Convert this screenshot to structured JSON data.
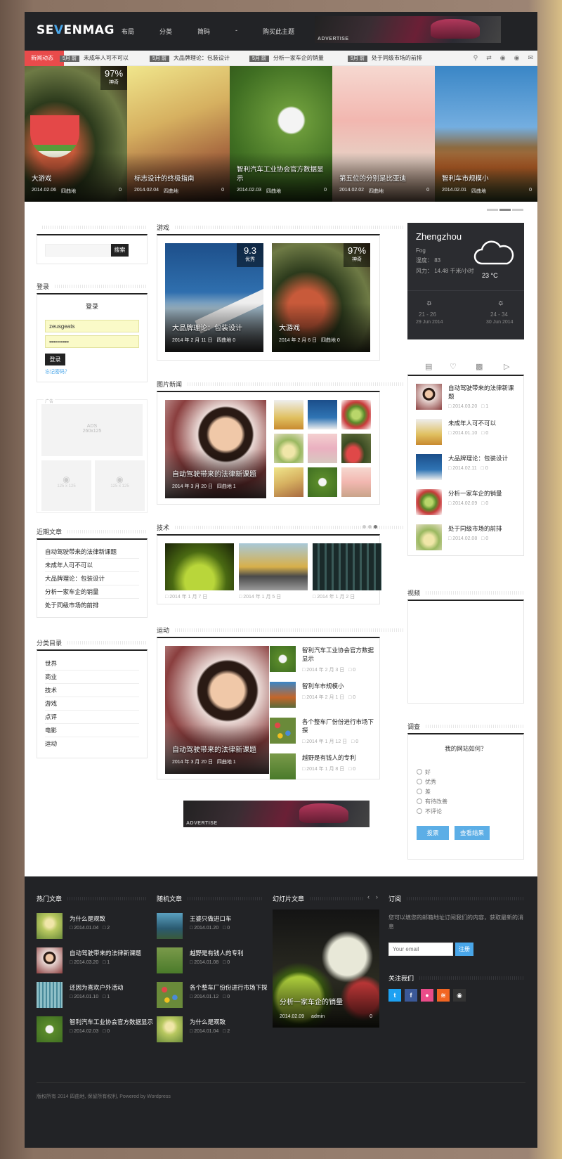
{
  "header": {
    "logo_a": "SE",
    "logo_b": "V",
    "logo_c": "ENMAG",
    "nav": [
      "布局",
      "分类",
      "简码",
      "-",
      "购买此主题"
    ],
    "advertise": "ADVERTISE"
  },
  "ticker": {
    "label": "新闻动态",
    "items": [
      {
        "age": "5月 前",
        "title": "未成年人可不可以"
      },
      {
        "age": "5月 前",
        "title": "大品牌理论：包装设计"
      },
      {
        "age": "5月 前",
        "title": "分析一家车企的销量"
      },
      {
        "age": "5月 前",
        "title": "处于同级市场的前排"
      }
    ]
  },
  "slider": [
    {
      "title": "大游戏",
      "date": "2014.02.06",
      "author": "四曲地",
      "comments": "0",
      "score": "97%",
      "score_label": "神奇"
    },
    {
      "title": "标志设计的终极指南",
      "date": "2014.02.04",
      "author": "四曲地",
      "comments": "0"
    },
    {
      "title": "智利汽车工业协会官方数据显示",
      "date": "2014.02.03",
      "author": "四曲地",
      "comments": "0"
    },
    {
      "title": "第五位的分别是比亚迪",
      "date": "2014.02.02",
      "author": "四曲地",
      "comments": "0"
    },
    {
      "title": "智利车市规模小",
      "date": "2014.02.01",
      "author": "四曲地",
      "comments": "0"
    }
  ],
  "search": {
    "button": "搜索",
    "placeholder": ""
  },
  "login": {
    "title": "登录",
    "heading": "登录",
    "username": "zeusgeats",
    "password": "••••••••••",
    "button": "登录",
    "forgot": "忘记密码？"
  },
  "ads": {
    "label": "广告",
    "big": "ADS",
    "big_size": "260x125",
    "small_size": "125 x 125"
  },
  "recent": {
    "title": "近期文章",
    "items": [
      "自动驾驶带来的法律新课题",
      "未成年人可不可以",
      "大品牌理论：包装设计",
      "分析一家车企的销量",
      "处于同级市场的前排"
    ]
  },
  "categories": {
    "title": "分类目录",
    "items": [
      "世界",
      "商业",
      "技术",
      "游戏",
      "点评",
      "电影",
      "运动"
    ]
  },
  "games": {
    "title": "游戏",
    "cards": [
      {
        "title": "大品牌理论：包装设计",
        "date": "2014 年 2 月 11 日",
        "author": "四曲地",
        "comments": "0",
        "score": "9.3",
        "score_label": "优秀"
      },
      {
        "title": "大游戏",
        "date": "2014 年 2 月 6 日",
        "author": "四曲地",
        "comments": "0",
        "score": "97%",
        "score_label": "神奇"
      }
    ]
  },
  "photo": {
    "title": "图片新闻",
    "main_title": "自动驾驶带来的法律新课题",
    "date": "2014 年 3 月 20 日",
    "author": "四曲地",
    "comments": "1"
  },
  "tech": {
    "title": "技术",
    "items": [
      {
        "date": "2014 年 1 月 7 日"
      },
      {
        "date": "2014 年 1 月 5 日"
      },
      {
        "date": "2014 年 1 月 2 日"
      }
    ]
  },
  "sports": {
    "title": "运动",
    "main_title": "自动驾驶带来的法律新课题",
    "date": "2014 年 3 月 20 日",
    "author": "四曲地",
    "comments": "1",
    "items": [
      {
        "title": "智利汽车工业协会官方数据显示",
        "date": "2014 年 2 月 3 日",
        "comments": "0"
      },
      {
        "title": "智利车市规模小",
        "date": "2014 年 2 月 1 日",
        "comments": "0"
      },
      {
        "title": "各个整车厂份份进行市场下探",
        "date": "2014 年 1 月 12 日",
        "comments": "0"
      },
      {
        "title": "越野是有钱人的专利",
        "date": "2014 年 1 月 8 日",
        "comments": "0"
      }
    ]
  },
  "weather": {
    "city": "Zhengzhou",
    "condition": "Fog",
    "humidity": "湿度：  83",
    "wind": "风力：  14.48 千米/小时",
    "temp": "23 °C",
    "day1": {
      "range": "21 - 26",
      "date": "29 Jun 2014"
    },
    "day2": {
      "range": "24 - 34",
      "date": "30 Jun 2014"
    }
  },
  "tabs": {
    "items": [
      {
        "title": "自动驾驶带来的法律新课题",
        "date": "2014.03.20",
        "comments": "1"
      },
      {
        "title": "未成年人可不可以",
        "date": "2014.01.10",
        "comments": "0"
      },
      {
        "title": "大品牌理论：包装设计",
        "date": "2014.02.11",
        "comments": "0"
      },
      {
        "title": "分析一家车企的销量",
        "date": "2014.02.09",
        "comments": "0"
      },
      {
        "title": "处于同级市场的前排",
        "date": "2014.02.08",
        "comments": "0"
      }
    ]
  },
  "video": {
    "title": "视频"
  },
  "poll": {
    "title": "调查",
    "question": "我的网站如何？",
    "options": [
      "好",
      "优秀",
      "差",
      "有待改善",
      "不评论"
    ],
    "vote": "投票",
    "results": "查看结果"
  },
  "footer": {
    "hot": {
      "title": "热门文章",
      "items": [
        {
          "title": "为什么是观致",
          "date": "2014.01.04",
          "comments": "2"
        },
        {
          "title": "自动驾驶带来的法律新课题",
          "date": "2014.03.20",
          "comments": "1"
        },
        {
          "title": "还因为喜欢户外活动",
          "date": "2014.01.10",
          "comments": "1"
        },
        {
          "title": "智利汽车工业协会官方数据显示",
          "date": "2014.02.03",
          "comments": "0"
        }
      ]
    },
    "random": {
      "title": "随机文章",
      "items": [
        {
          "title": "王婆只做进口车",
          "date": "2014.01.20",
          "comments": "0"
        },
        {
          "title": "越野是有钱人的专利",
          "date": "2014.01.08",
          "comments": "0"
        },
        {
          "title": "各个整车厂份份进行市场下探",
          "date": "2014.01.12",
          "comments": "0"
        },
        {
          "title": "为什么是观致",
          "date": "2014.01.04",
          "comments": "2"
        }
      ]
    },
    "slideshow": {
      "title": "幻灯片文章",
      "post_title": "分析一家车企的销量",
      "date": "2014.02.09",
      "author": "admin",
      "comments": "0"
    },
    "subscribe": {
      "title": "订阅",
      "text": "您可以填您的邮箱地址订阅我们的内容，获取最新的消息",
      "placeholder": "Your email",
      "button": "注册"
    },
    "follow": {
      "title": "关注我们"
    },
    "copyright": "版权所有 2014 四曲地, 保留所有权利, Powered by Wordpress"
  },
  "colors": {
    "accent": "#49a6e9",
    "ticker_tag": "#e94b4b",
    "dark": "#222326"
  }
}
